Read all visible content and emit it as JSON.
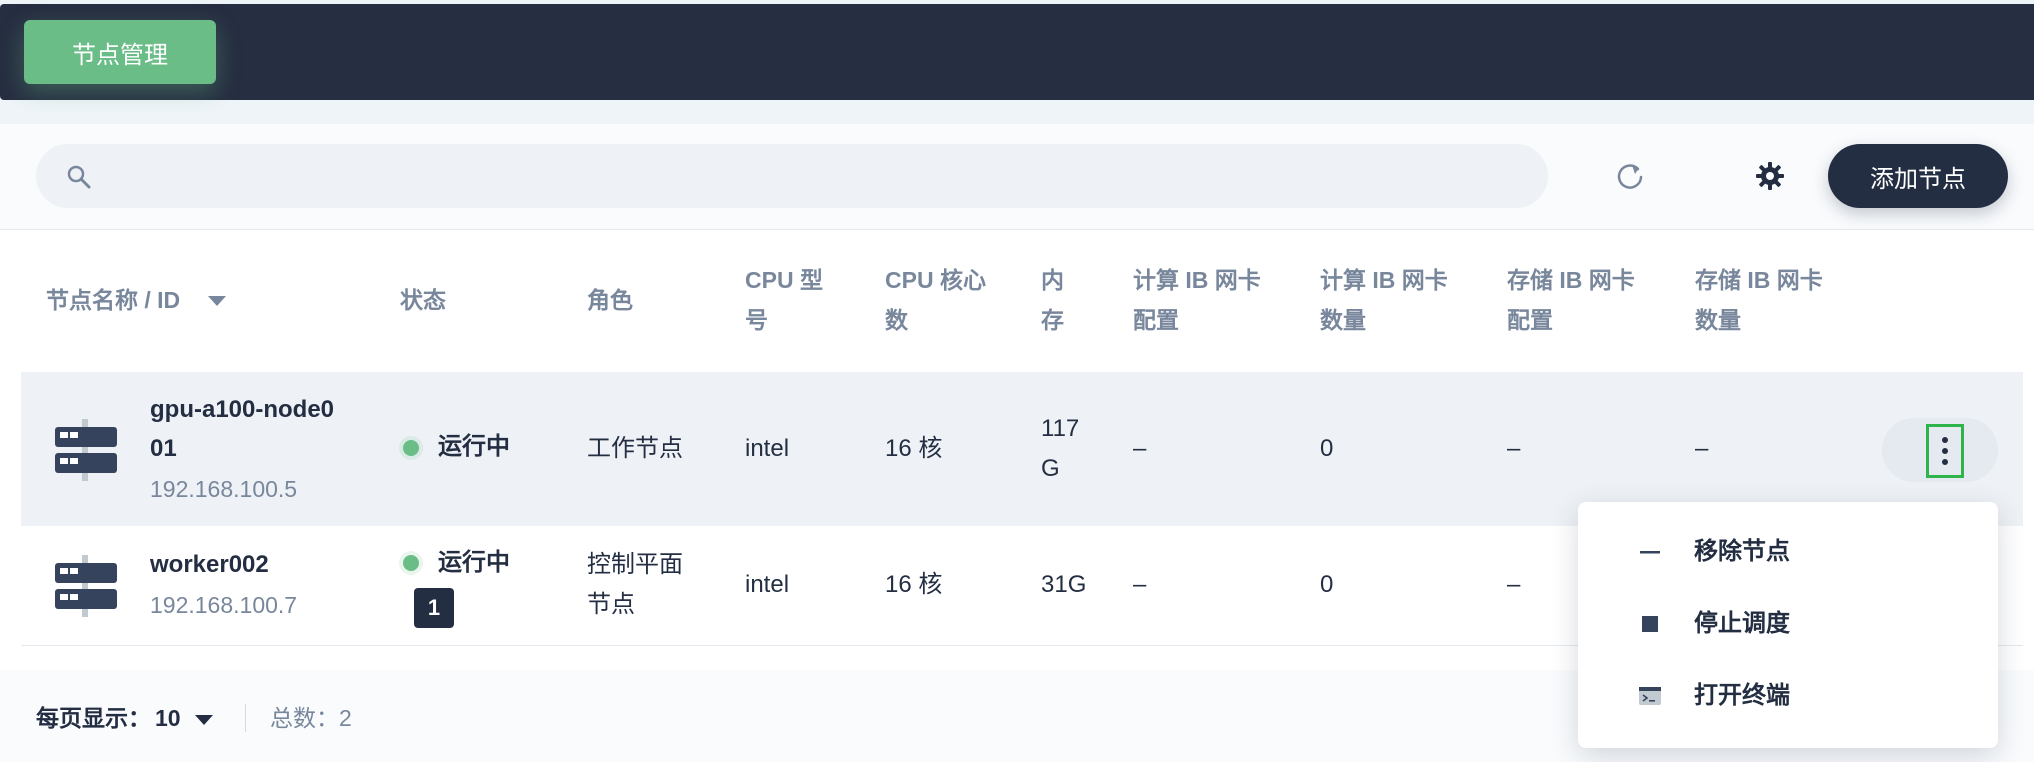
{
  "header": {
    "tab_label": "节点管理"
  },
  "toolbar": {
    "search_placeholder": "",
    "search_icon": "search-icon",
    "refresh_icon": "refresh-icon",
    "settings_icon": "gear-icon",
    "add_button": "添加节点"
  },
  "table": {
    "columns": [
      "节点名称 / ID",
      "状态",
      "角色",
      "CPU 型号",
      "CPU 核心数",
      "内存",
      "计算 IB 网卡配置",
      "计算 IB 网卡数量",
      "存储 IB 网卡配置",
      "存储 IB 网卡数量"
    ],
    "column_wrapped": {
      "cpu_model_1": "CPU 型",
      "cpu_model_2": "号",
      "cpu_cores_1": "CPU 核心",
      "cpu_cores_2": "数",
      "memory_1": "内",
      "memory_2": "存",
      "compute_ib_cfg_1": "计算 IB 网卡",
      "compute_ib_cfg_2": "配置",
      "compute_ib_cnt_1": "计算 IB 网卡",
      "compute_ib_cnt_2": "数量",
      "storage_ib_cfg_1": "存储 IB 网卡",
      "storage_ib_cfg_2": "配置",
      "storage_ib_cnt_1": "存储 IB 网卡",
      "storage_ib_cnt_2": "数量"
    },
    "sort_icon": "caret-down-icon",
    "rows": [
      {
        "name_line1": "gpu-a100-node0",
        "name_line2": "01",
        "ip": "192.168.100.5",
        "status": "运行中",
        "role_line1": "工作节点",
        "role_line2": "",
        "cpu_model": "intel",
        "cpu_cores": "16 核",
        "memory_line1": "117",
        "memory_line2": "G",
        "compute_ib_cfg": "–",
        "compute_ib_cnt": "0",
        "storage_ib_cfg": "–",
        "storage_ib_cnt": "–"
      },
      {
        "name_line1": "worker002",
        "ip": "192.168.100.7",
        "status": "运行中",
        "role_line1": "控制平面",
        "role_line2": "节点",
        "cpu_model": "intel",
        "cpu_cores": "16 核",
        "memory_line1": "31G",
        "compute_ib_cfg": "–",
        "compute_ib_cnt": "0",
        "storage_ib_cfg": "–"
      }
    ],
    "status_color": "#6bbd88",
    "tooltip_badge": "1"
  },
  "menu": {
    "items": [
      {
        "label": "移除节点",
        "icon": "minus-icon"
      },
      {
        "label": "停止调度",
        "icon": "stop-icon"
      },
      {
        "label": "打开终端",
        "icon": "terminal-icon"
      }
    ]
  },
  "footer": {
    "per_page_label": "每页显示：",
    "per_page_value": "10",
    "total_label": "总数：",
    "total_value": "2"
  },
  "colors": {
    "header_bg": "#262e41",
    "tab_accent": "#6bbd88",
    "primary_button": "#242e42",
    "focus_outline": "#2fb34b"
  }
}
